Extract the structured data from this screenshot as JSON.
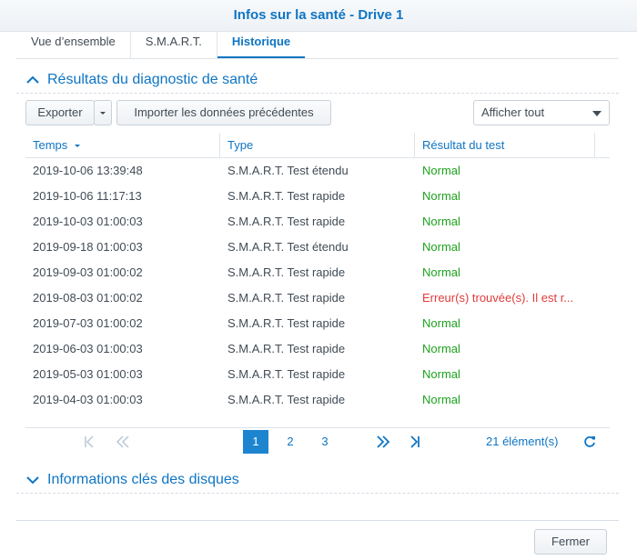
{
  "window": {
    "title": "Infos sur la santé - Drive 1"
  },
  "tabs": [
    {
      "label": "Vue d’ensemble",
      "active": false
    },
    {
      "label": "S.M.A.R.T.",
      "active": false
    },
    {
      "label": "Historique",
      "active": true
    }
  ],
  "section_history": {
    "title": "Résultats du diagnostic de santé",
    "expanded": true
  },
  "toolbar": {
    "export_label": "Exporter",
    "import_label": "Importer les données précédentes",
    "filter_value": "Afficher tout"
  },
  "grid": {
    "columns": [
      "Temps",
      "Type",
      "Résultat du test"
    ],
    "rows": [
      {
        "time": "2019-10-06 13:39:48",
        "type": "S.M.A.R.T. Test étendu",
        "result": "Normal",
        "status": "ok"
      },
      {
        "time": "2019-10-06 11:17:13",
        "type": "S.M.A.R.T. Test rapide",
        "result": "Normal",
        "status": "ok"
      },
      {
        "time": "2019-10-03 01:00:03",
        "type": "S.M.A.R.T. Test rapide",
        "result": "Normal",
        "status": "ok"
      },
      {
        "time": "2019-09-18 01:00:03",
        "type": "S.M.A.R.T. Test étendu",
        "result": "Normal",
        "status": "ok"
      },
      {
        "time": "2019-09-03 01:00:02",
        "type": "S.M.A.R.T. Test rapide",
        "result": "Normal",
        "status": "ok"
      },
      {
        "time": "2019-08-03 01:00:02",
        "type": "S.M.A.R.T. Test rapide",
        "result": "Erreur(s) trouvée(s). Il est r...",
        "status": "error"
      },
      {
        "time": "2019-07-03 01:00:02",
        "type": "S.M.A.R.T. Test rapide",
        "result": "Normal",
        "status": "ok"
      },
      {
        "time": "2019-06-03 01:00:03",
        "type": "S.M.A.R.T. Test rapide",
        "result": "Normal",
        "status": "ok"
      },
      {
        "time": "2019-05-03 01:00:03",
        "type": "S.M.A.R.T. Test rapide",
        "result": "Normal",
        "status": "ok"
      },
      {
        "time": "2019-04-03 01:00:03",
        "type": "S.M.A.R.T. Test rapide",
        "result": "Normal",
        "status": "ok"
      }
    ]
  },
  "pager": {
    "pages": [
      "1",
      "2",
      "3"
    ],
    "current_page": "1",
    "count": "21 élément(s)"
  },
  "section_disks": {
    "title": "Informations clés des disques",
    "expanded": false
  },
  "footer": {
    "close_label": "Fermer"
  },
  "colors": {
    "accent": "#0f75c3",
    "ok": "#1ca31c",
    "error": "#e23a3a"
  }
}
